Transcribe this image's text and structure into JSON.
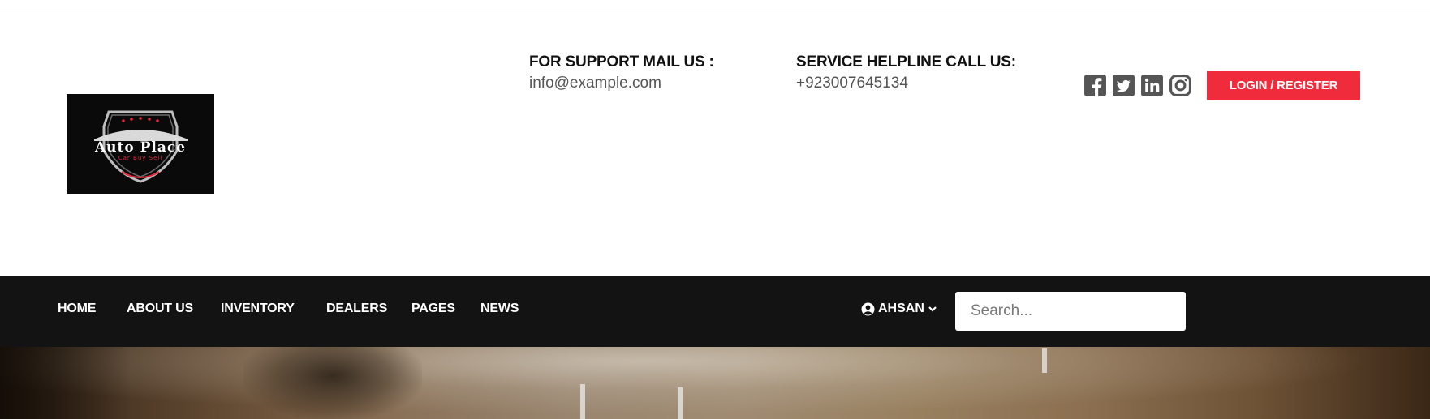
{
  "header": {
    "logo": {
      "name": "Auto Place",
      "tagline": "Car Buy Sell"
    },
    "support": {
      "label": "FOR SUPPORT MAIL US :",
      "value": "info@example.com"
    },
    "helpline": {
      "label": "SERVICE HELPLINE CALL US:",
      "value": "+923007645134"
    },
    "social": [
      "facebook-icon",
      "twitter-icon",
      "linkedin-icon",
      "instagram-icon"
    ],
    "login_label": "LOGIN / REGISTER"
  },
  "nav": {
    "items": [
      "HOME",
      "ABOUT US",
      "INVENTORY",
      "DEALERS",
      "PAGES",
      "NEWS"
    ],
    "user_name": "AHSAN",
    "search_placeholder": "Search..."
  },
  "colors": {
    "accent": "#ef2b3c",
    "navbar": "#131313",
    "icon": "#555555"
  }
}
